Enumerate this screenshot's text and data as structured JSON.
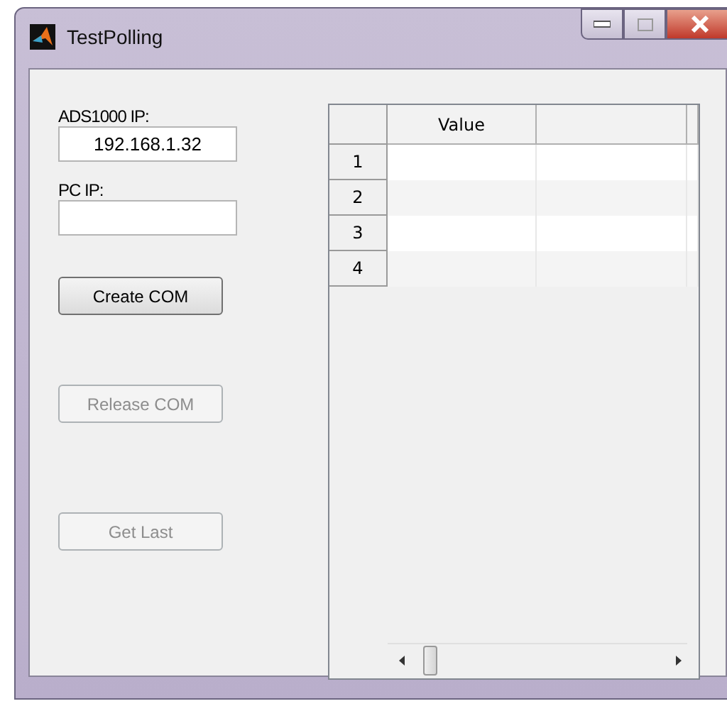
{
  "window": {
    "title": "TestPolling"
  },
  "fields": [
    {
      "label": "ADS1000 IP:",
      "value": "192.168.1.32"
    },
    {
      "label": "PC IP:"
    }
  ],
  "buttons": [
    {
      "label": "Create COM",
      "disabled": false
    },
    {
      "label": "Release COM",
      "disabled": true
    },
    {
      "label": "Get Last",
      "disabled": true
    }
  ],
  "table": {
    "columns": [
      "Value"
    ],
    "rows": [
      {
        "header": "1"
      },
      {
        "header": "2"
      },
      {
        "header": "3"
      },
      {
        "header": "4"
      }
    ]
  }
}
